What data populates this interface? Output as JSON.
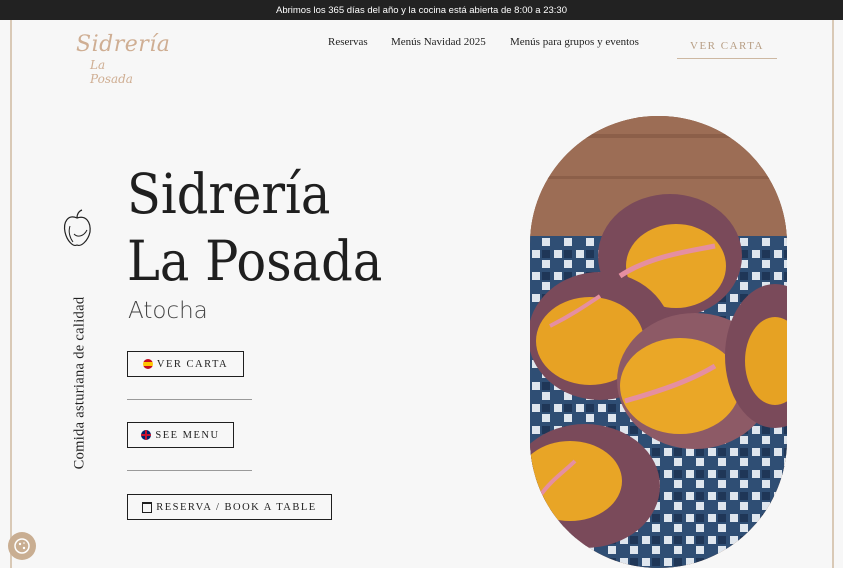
{
  "topbar": {
    "text": "Abrimos los 365 días del año y la cocina está abierta de 8:00 a 23:30"
  },
  "logo": {
    "title": "Sidrería",
    "sub": "La Posada"
  },
  "nav": {
    "items": [
      "Reservas",
      "Menús Navidad 2025",
      "Menús para grupos y eventos"
    ],
    "cta": "VER CARTA"
  },
  "side": {
    "text": "Comida asturiana de calidad",
    "icon": "apple-icon"
  },
  "hero": {
    "title_line1": "Sidrería",
    "title_line2": "La Posada",
    "subtitle": "Atocha"
  },
  "buttons": {
    "ver_carta": "VER CARTA",
    "see_menu": "SEE MENU",
    "reserva": "RESERVA / BOOK A TABLE"
  },
  "icons": {
    "flag_es": "spain-flag-icon",
    "flag_uk": "uk-flag-icon",
    "calendar": "calendar-check-icon",
    "cookie": "cookie-settings-icon"
  },
  "colors": {
    "accent": "#cfae93",
    "topbar": "#222222",
    "frame": "#d9c9b6"
  }
}
